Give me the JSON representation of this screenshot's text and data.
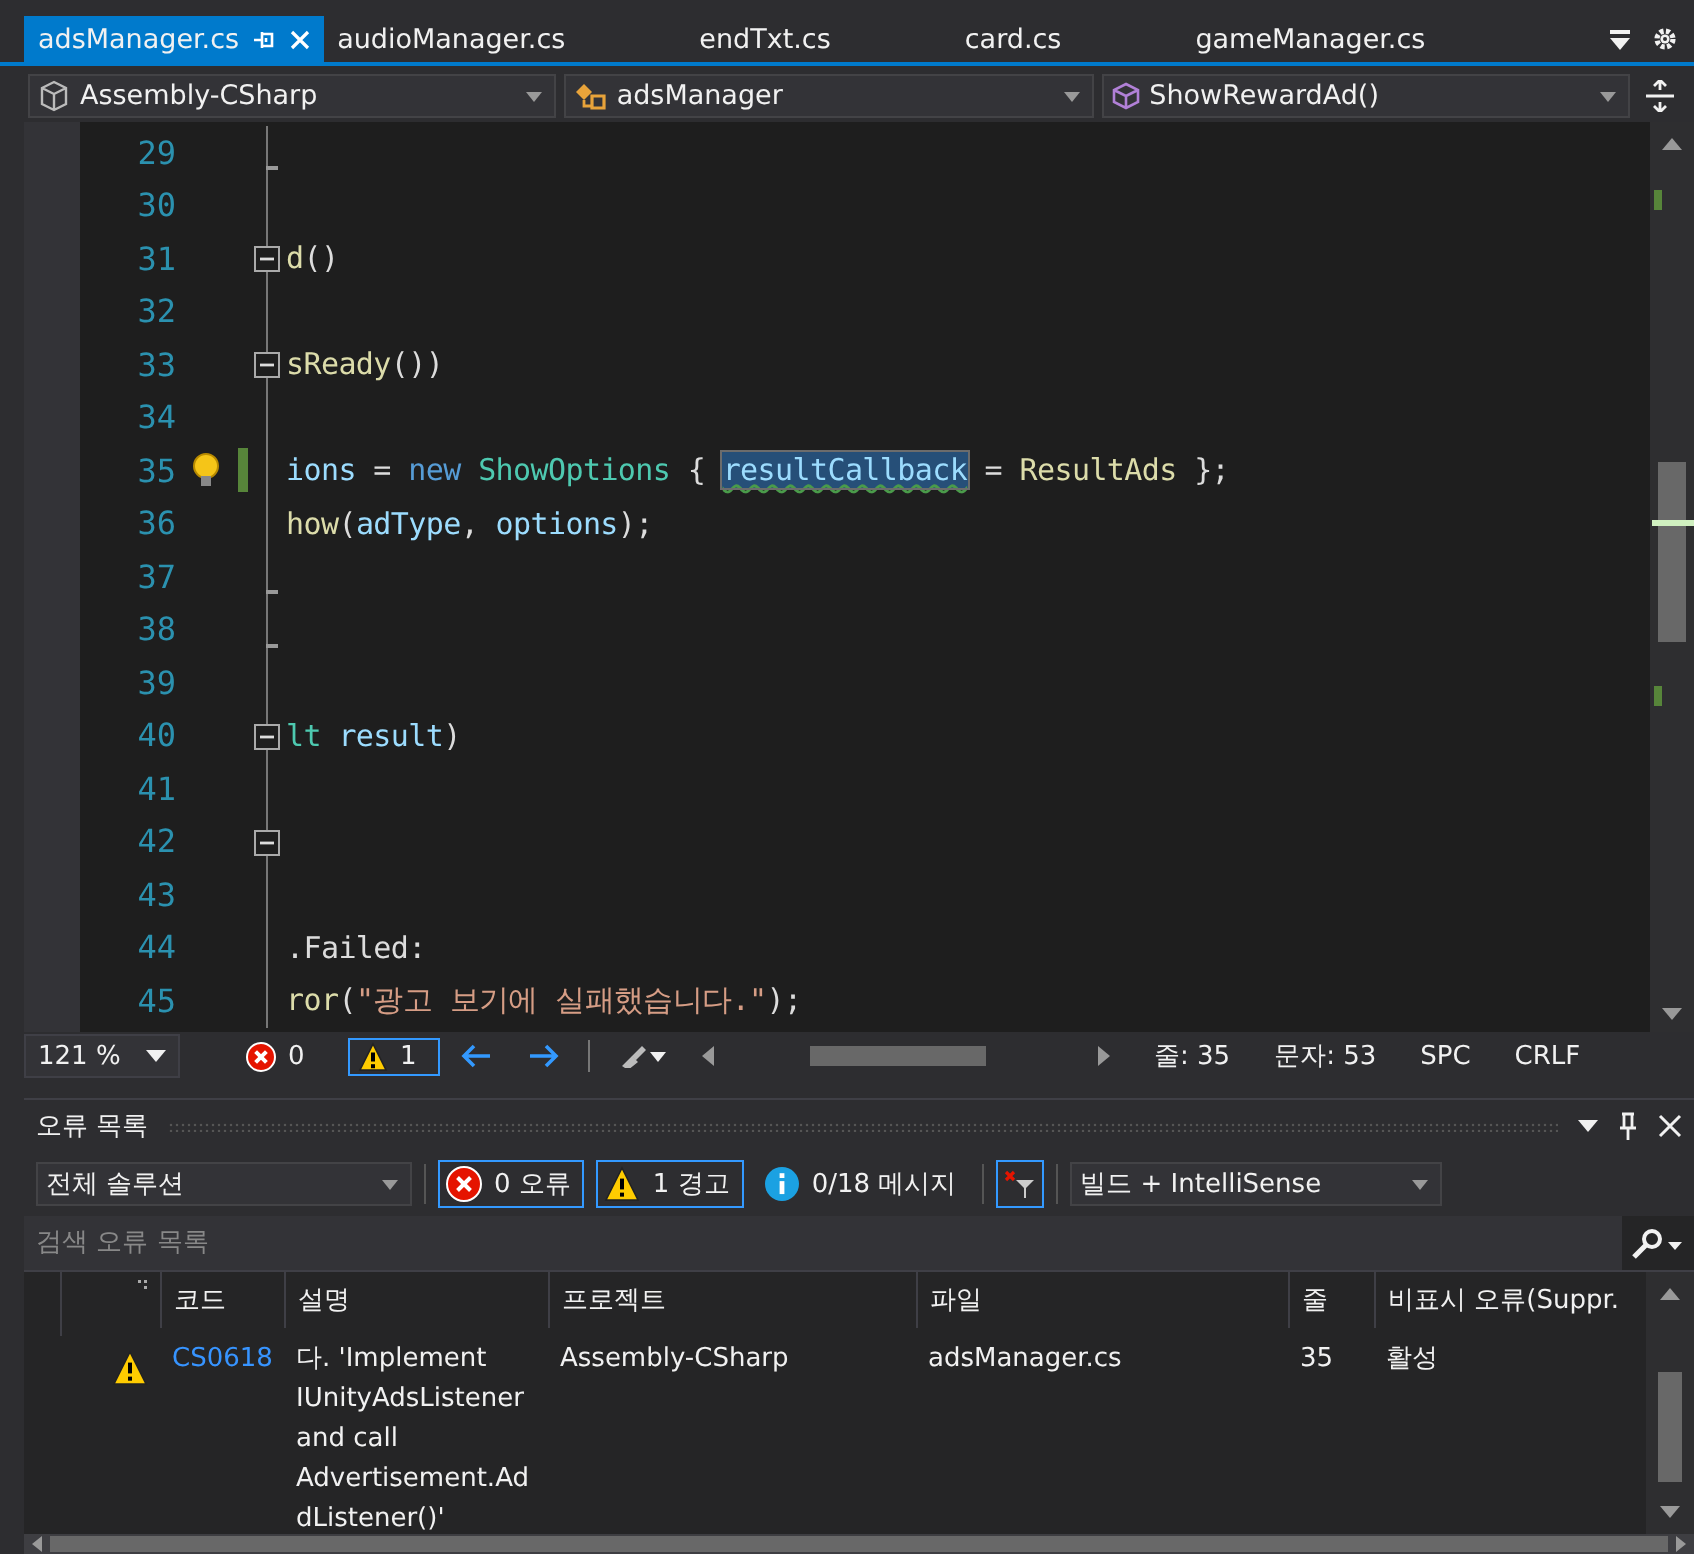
{
  "tabs": [
    {
      "label": "adsManager.cs",
      "selected": true,
      "pinned": true
    },
    {
      "label": "audioManager.cs",
      "selected": false,
      "pinned": false
    },
    {
      "label": "endTxt.cs",
      "selected": false,
      "pinned": false
    },
    {
      "label": "card.cs",
      "selected": false,
      "pinned": false
    },
    {
      "label": "gameManager.cs",
      "selected": false,
      "pinned": false
    }
  ],
  "nav": [
    {
      "label": "Assembly-CSharp",
      "kind": "project"
    },
    {
      "label": "adsManager",
      "kind": "class"
    },
    {
      "label": "ShowRewardAd()",
      "kind": "method"
    }
  ],
  "editor": {
    "lines": [
      {
        "number": "29",
        "block_end": true
      },
      {
        "number": "30"
      },
      {
        "number": "31",
        "collapsible": true,
        "tokens": [
          {
            "text": "d",
            "kind": "method"
          },
          {
            "text": "()",
            "kind": "plain"
          }
        ]
      },
      {
        "number": "32"
      },
      {
        "number": "33",
        "collapsible": true,
        "tokens": [
          {
            "text": "sReady",
            "kind": "method"
          },
          {
            "text": "())",
            "kind": "plain"
          }
        ]
      },
      {
        "number": "34"
      },
      {
        "number": "35",
        "lightbulb": true,
        "changed": true,
        "tokens": [
          {
            "text": "ions",
            "kind": "ident"
          },
          {
            "text": " = ",
            "kind": "plain"
          },
          {
            "text": "new ",
            "kind": "keyword"
          },
          {
            "text": "ShowOptions",
            "kind": "type"
          },
          {
            "text": " { ",
            "kind": "plain"
          },
          {
            "text": "resultCallback",
            "kind": "highlight"
          },
          {
            "text": " = ",
            "kind": "plain"
          },
          {
            "text": "ResultAds",
            "kind": "method"
          },
          {
            "text": " };",
            "kind": "plain"
          }
        ]
      },
      {
        "number": "36",
        "tokens": [
          {
            "text": "how",
            "kind": "method"
          },
          {
            "text": "(",
            "kind": "plain"
          },
          {
            "text": "adType",
            "kind": "ident"
          },
          {
            "text": ", ",
            "kind": "plain"
          },
          {
            "text": "options",
            "kind": "ident"
          },
          {
            "text": ");",
            "kind": "plain"
          }
        ]
      },
      {
        "number": "37",
        "block_end": true
      },
      {
        "number": "38",
        "block_end": true
      },
      {
        "number": "39"
      },
      {
        "number": "40",
        "collapsible": true,
        "tokens": [
          {
            "text": "lt ",
            "kind": "type"
          },
          {
            "text": "result",
            "kind": "ident"
          },
          {
            "text": ")",
            "kind": "plain"
          }
        ]
      },
      {
        "number": "41"
      },
      {
        "number": "42",
        "collapsible": true
      },
      {
        "number": "43"
      },
      {
        "number": "44",
        "tokens": [
          {
            "text": ".Failed:",
            "kind": "plain"
          }
        ]
      },
      {
        "number": "45",
        "tokens": [
          {
            "text": "ror",
            "kind": "method"
          },
          {
            "text": "(",
            "kind": "plain"
          },
          {
            "text": "\"광고 보기에 실패했습니다.\"",
            "kind": "string"
          },
          {
            "text": ");",
            "kind": "plain"
          }
        ]
      }
    ]
  },
  "status_bar": {
    "zoom": "121 %",
    "errors": {
      "count": "0",
      "selected": false
    },
    "warnings": {
      "count": "1",
      "selected": true
    },
    "line": "줄: 35",
    "column": "문자: 53",
    "indent": "SPC",
    "line_ending": "CRLF"
  },
  "error_list": {
    "title": "오류 목록",
    "scope": "전체 솔루션",
    "filters": [
      {
        "kind": "error",
        "label": "0 오류",
        "selected": true
      },
      {
        "kind": "warning",
        "label": "1 경고",
        "selected": true
      },
      {
        "kind": "info",
        "label": "0/18 메시지",
        "selected": false
      }
    ],
    "source": "빌드 + IntelliSense",
    "search": {
      "placeholder": "검색 오류 목록"
    },
    "columns": [
      "코드",
      "설명",
      "프로젝트",
      "파일",
      "줄",
      "비표시 오류(Suppr."
    ],
    "rows": [
      {
        "kind": "warning",
        "code": "CS0618",
        "description": "다. 'Implement IUnityAdsListener and call Advertisement.AddListener()'",
        "project": "Assembly-CSharp",
        "file": "adsManager.cs",
        "line": "35",
        "suppression": "활성"
      }
    ]
  }
}
